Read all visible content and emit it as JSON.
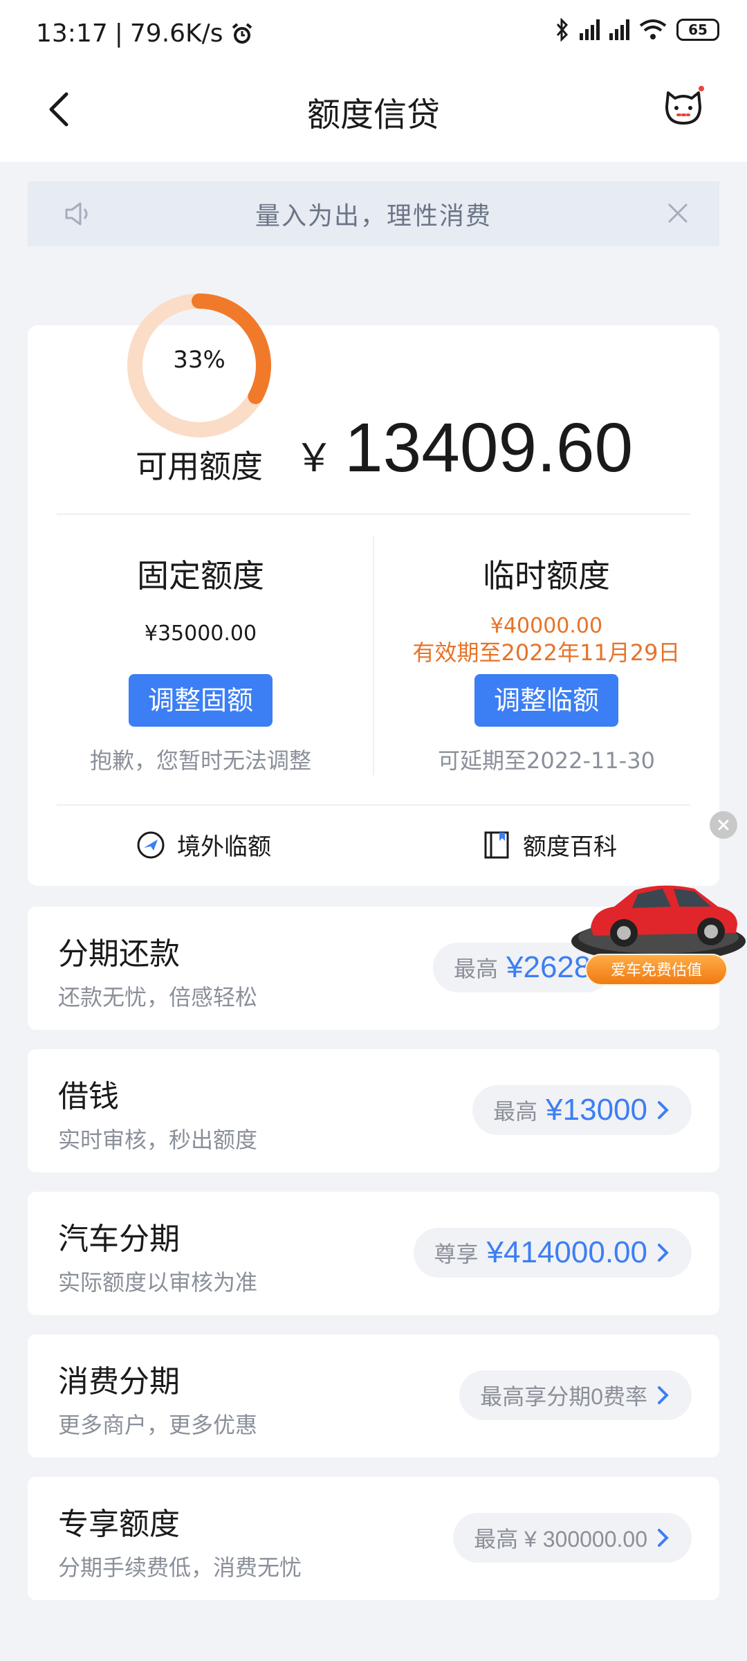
{
  "status": {
    "time": "13:17",
    "speed": "79.6K/s",
    "battery": "65"
  },
  "nav": {
    "title": "额度信贷"
  },
  "notice": {
    "text": "量入为出，理性消费"
  },
  "credit": {
    "percent": "33%",
    "percent_value": 0.33,
    "available_label": "可用额度",
    "currency": "￥",
    "available_amount": "13409.60",
    "fixed": {
      "title": "固定额度",
      "amount": "¥35000.00",
      "button": "调整固额",
      "note": "抱歉，您暂时无法调整"
    },
    "temp": {
      "title": "临时额度",
      "amount": "¥40000.00",
      "validity": "有效期至2022年11月29日",
      "button": "调整临额",
      "note": "可延期至2022-11-30"
    },
    "shortcuts": {
      "overseas": "境外临额",
      "encyclopedia": "额度百科"
    }
  },
  "products": [
    {
      "title": "分期还款",
      "subtitle": "还款无忧，倍感轻松",
      "label": "最高",
      "value": "¥2628"
    },
    {
      "title": "借钱",
      "subtitle": "实时审核，秒出额度",
      "label": "最高",
      "value": "¥13000"
    },
    {
      "title": "汽车分期",
      "subtitle": "实际额度以审核为准",
      "label": "尊享",
      "value": "¥414000.00"
    },
    {
      "title": "消费分期",
      "subtitle": "更多商户，更多优惠",
      "label": "",
      "value": "最高享分期0费率"
    },
    {
      "title": "专享额度",
      "subtitle": "分期手续费低，消费无忧",
      "label": "",
      "value": "最高 ¥ 300000.00"
    }
  ],
  "ad": {
    "label": "爱车免费估值"
  },
  "colors": {
    "accent_blue": "#3c7ef4",
    "accent_orange": "#f07a2a",
    "ring_track": "#fbdcc6"
  }
}
